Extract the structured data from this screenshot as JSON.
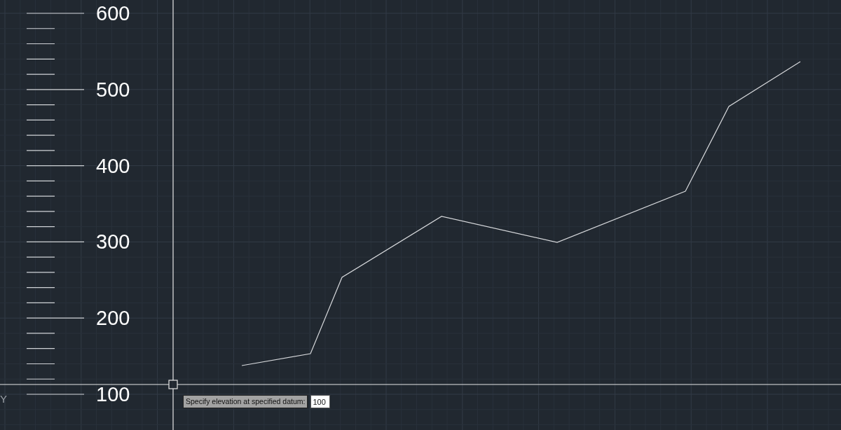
{
  "scale": {
    "labels": [
      "600",
      "500",
      "400",
      "300",
      "200",
      "100"
    ]
  },
  "ucs": {
    "axis_label": "Y"
  },
  "prompt": {
    "label": "Specify elevation at specified datum:",
    "value": "100"
  }
}
